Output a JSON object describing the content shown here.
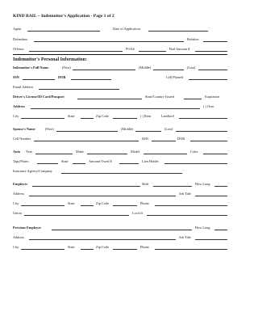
{
  "title": "KIND BAIL – Indemnitor's Application - Page 1 of 2",
  "header": {
    "agent": "Agent",
    "date_of_application": "Date of Application",
    "defendant": "Defendant",
    "relation": "Relation",
    "offense": "Offense",
    "poa": "POA#",
    "bail_amount": "Bail Amount $"
  },
  "personal": {
    "heading": "Indemnitor's Personal Information:",
    "full_name": "Indemnitor's Full Name",
    "first": "(First)",
    "middle": "(Middle)",
    "last": "(Last)",
    "ssn": "SSN",
    "dob": "DOB",
    "cell_phone": "Cell Phone#",
    "email": "Email Address",
    "license": "Driver's License/ID Card/Passport",
    "state_country_issued": "State/Country Issued",
    "expiration": "Expiration",
    "address": "Address",
    "own": "(  ) Own",
    "city": "City",
    "state": "State",
    "zip": "Zip Code",
    "rent": "(  ) Rent",
    "landlord": "Landlord"
  },
  "spouse": {
    "name": "Spouse's Name",
    "first": "(First)",
    "middle": "(Middle)",
    "last": "(Last)",
    "cell_number": "Cell Number",
    "ssn": "SSN",
    "dob": "DOB"
  },
  "auto": {
    "label": "Auto",
    "year": "Year",
    "make": "Make",
    "model": "Model",
    "color": "Color",
    "tags": "Tags/Plates",
    "state": "State",
    "amount_owed": "Amount Owed $",
    "lien_holder": "Lien Holder",
    "insurance": "Insurance Agency/Company"
  },
  "employer": {
    "label": "Employer",
    "shift": "Shift",
    "how_long": "How Long",
    "address": "Address",
    "job_title": "Job Title",
    "city": "City",
    "state": "State",
    "zip": "Zip Code",
    "phone": "Phone",
    "union": "Union",
    "local": "Local #"
  },
  "previous_employer": {
    "label": "Previous Employer",
    "how_long": "How Long",
    "address": "Address",
    "job_title": "Job Title",
    "city": "City",
    "state": "State",
    "zip": "Zip Code",
    "phone": "Phone"
  }
}
